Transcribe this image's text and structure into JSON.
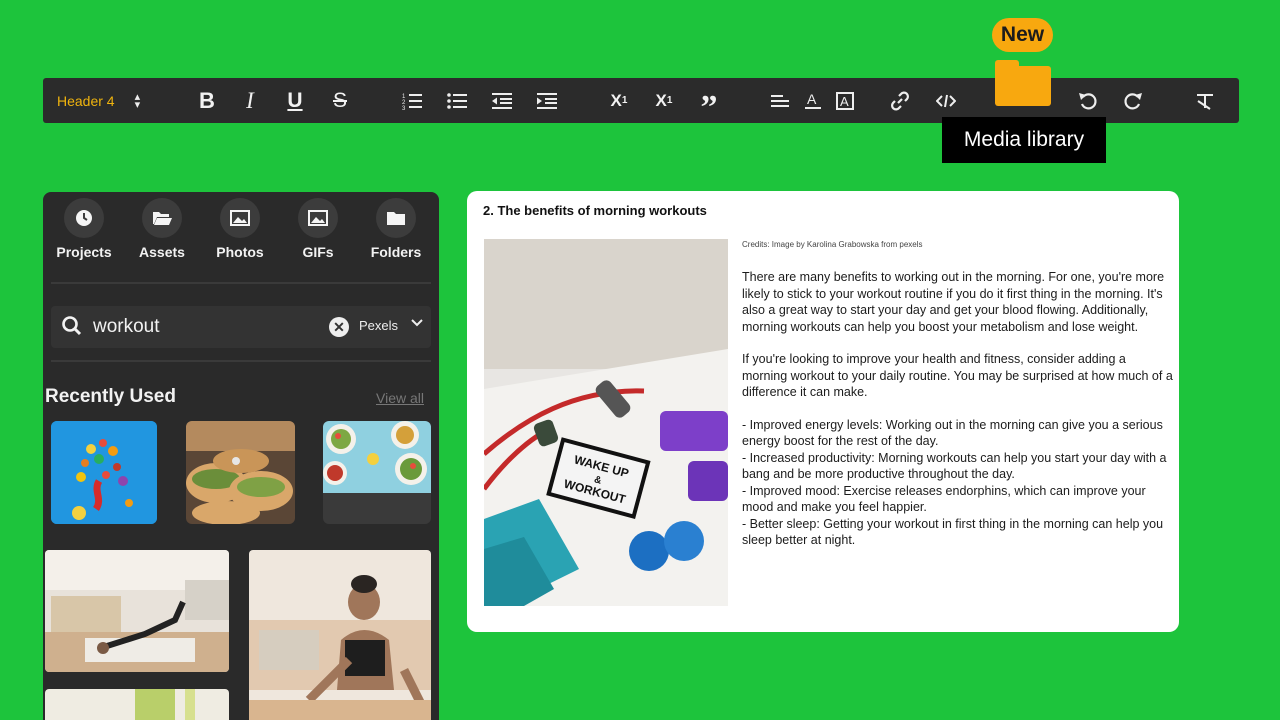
{
  "toolbar": {
    "header_select": "Header 4",
    "new_badge": "New",
    "tooltip": "Media library",
    "icons": {
      "bold": "B",
      "italic": "I",
      "underline": "U",
      "strike": "S",
      "superscript": "X",
      "subscript": "X",
      "quote": "”"
    }
  },
  "sidebar": {
    "nav": [
      {
        "label": "Projects",
        "icon": "clock-icon"
      },
      {
        "label": "Assets",
        "icon": "folder-open-icon"
      },
      {
        "label": "Photos",
        "icon": "image-icon"
      },
      {
        "label": "GIFs",
        "icon": "gif-image-icon"
      },
      {
        "label": "Folders",
        "icon": "folder-icon"
      }
    ],
    "search": {
      "value": "workout",
      "source": "Pexels"
    },
    "recently_used": "Recently Used",
    "view_all": "View all"
  },
  "document": {
    "title": "2. The benefits of morning workouts",
    "credits": "Credits: Image by Karolina Grabowska from pexels",
    "paragraphs": [
      "There are many benefits to working out in the morning. For one, you're more likely to stick to your workout routine if you do it first thing in the morning. It's also a great way to start your day and get your blood flowing. Additionally, morning workouts can help you boost your metabolism and lose weight.",
      "If you're looking to improve your health and fitness, consider adding a morning workout to your daily routine. You may be surprised at how much of a difference it can make."
    ],
    "bullets": [
      "- Improved energy levels: Working out in the morning can give you a serious energy boost for the rest of the day.",
      "- Increased productivity: Morning workouts can help you start your day with a bang and be more productive throughout the day.",
      "- Improved mood: Exercise releases endorphins, which can improve your mood and make you feel happier.",
      "- Better sleep: Getting your workout in first thing in the morning can help you sleep better at night."
    ],
    "image_sign": {
      "line1": "WAKE UP",
      "line2": "&",
      "line3": "WORKOUT"
    }
  },
  "colors": {
    "background": "#1dc43c",
    "toolbar": "#2b2b2b",
    "accent": "#f8a80f",
    "header_select": "#f0b40e"
  }
}
